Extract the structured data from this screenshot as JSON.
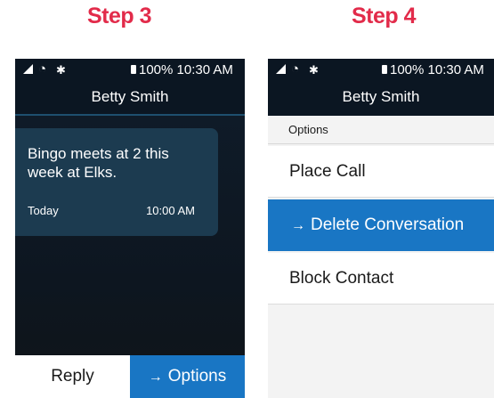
{
  "steps": [
    {
      "title": "Step 3"
    },
    {
      "title": "Step 4"
    }
  ],
  "status": {
    "battery": "100%",
    "time": "10:30 AM",
    "wifi_icon": "wifi-icon",
    "signal_icon": "signal-icon",
    "bluetooth_icon": "bluetooth-icon"
  },
  "contact_name": "Betty Smith",
  "message": {
    "text": "Bingo meets at 2 this week at Elks.",
    "date": "Today",
    "time": "10:00 AM"
  },
  "actions": {
    "reply_label": "Reply",
    "options_label": "Options",
    "arrow_glyph": "→"
  },
  "options_menu": {
    "header": "Options",
    "items": [
      {
        "label": "Place Call",
        "selected": false
      },
      {
        "label": "Delete Conversation",
        "selected": true
      },
      {
        "label": "Block Contact",
        "selected": false
      }
    ]
  },
  "colors": {
    "step_title": "#e22b4a",
    "accent_blue": "#1976c4",
    "dark_header": "#0b1622",
    "bubble": "#1c3b50"
  }
}
